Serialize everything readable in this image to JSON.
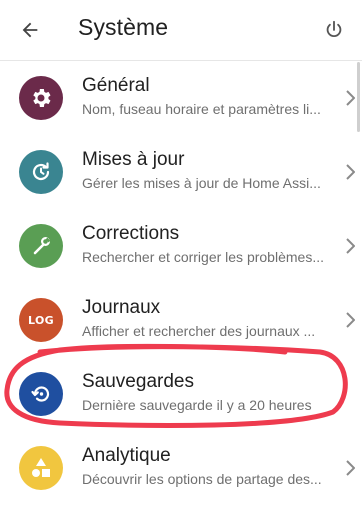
{
  "header": {
    "title": "Système",
    "back_icon": "arrow-back-icon",
    "power_icon": "power-icon"
  },
  "items": [
    {
      "label": "Général",
      "description": "Nom, fuseau horaire et paramètres li...",
      "icon": "gear-icon",
      "color": "#6b2a4a"
    },
    {
      "label": "Mises à jour",
      "description": "Gérer les mises à jour de Home Assi...",
      "icon": "update-icon",
      "color": "#3a8591"
    },
    {
      "label": "Corrections",
      "description": "Rechercher et corriger les problèmes...",
      "icon": "wrench-icon",
      "color": "#5a9e54"
    },
    {
      "label": "Journaux",
      "description": "Afficher et rechercher des journaux ...",
      "icon": "log-icon",
      "icon_text": "LOG",
      "color": "#c9512b"
    },
    {
      "label": "Sauvegardes",
      "description": "Dernière sauvegarde il y a 20 heures",
      "icon": "backup-icon",
      "color": "#1f4fa0"
    },
    {
      "label": "Analytique",
      "description": "Découvrir les options de partage des...",
      "icon": "shapes-icon",
      "color": "#f1c63f"
    }
  ],
  "annotation": {
    "color": "#ee3b4e"
  }
}
